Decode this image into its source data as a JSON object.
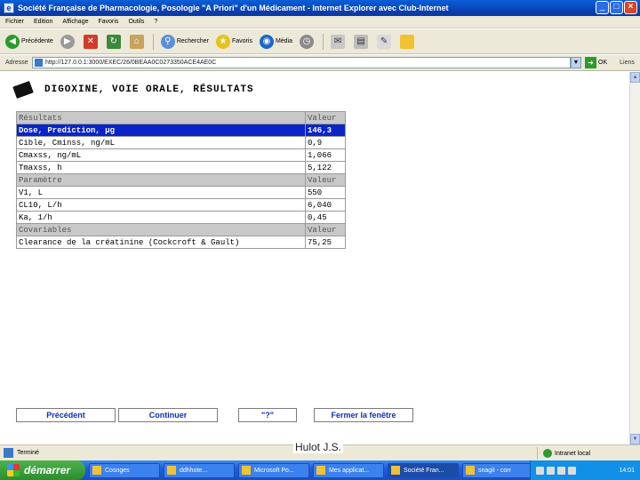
{
  "window": {
    "title": "Société Française de Pharmacologie, Posologie \"A Priori\" d'un Médicament - Internet Explorer avec Club-Internet",
    "min": "_",
    "max": "□",
    "close": "×"
  },
  "menu": [
    "Fichier",
    "Edition",
    "Affichage",
    "Favoris",
    "Outils",
    "?"
  ],
  "toolbar": {
    "back": "Précédente",
    "search": "Rechercher",
    "favorites": "Favoris",
    "media": "Média"
  },
  "address": {
    "label": "Adresse",
    "url": "http://127.0.0.1:3000/EXEC/26/0BEAA0C0273350ACE4AE0C",
    "go": "OK",
    "links": "Liens"
  },
  "page": {
    "title": "DIGOXINE, VOIE ORALE, RÉSULTATS",
    "rows": [
      {
        "kind": "section",
        "label": "Résultats",
        "value": "Valeur"
      },
      {
        "kind": "selected",
        "label": "Dose, Prediction, µg",
        "value": "146,3"
      },
      {
        "kind": "data",
        "label": "Cible, Cminss, ng/mL",
        "value": "0,9"
      },
      {
        "kind": "data",
        "label": "Cmaxss, ng/mL",
        "value": "1,066"
      },
      {
        "kind": "data",
        "label": "Tmaxss, h",
        "value": "5,122"
      },
      {
        "kind": "section",
        "label": "Paramètre",
        "value": "Valeur"
      },
      {
        "kind": "data",
        "label": "V1, L",
        "value": "550"
      },
      {
        "kind": "data",
        "label": "CL10, L/h",
        "value": "6,040"
      },
      {
        "kind": "data",
        "label": "Ka, 1/h",
        "value": "0,45"
      },
      {
        "kind": "section",
        "label": "Covariables",
        "value": "Valeur"
      },
      {
        "kind": "data",
        "label": "Clearance de la créatinine (Cockcroft & Gault)",
        "value": "75,25"
      }
    ],
    "buttons": {
      "previous": "Précédent",
      "continue": "Continuer",
      "help": "\"?\"",
      "close": "Fermer la fenêtre"
    }
  },
  "watermark": "Hulot J.S.",
  "status": {
    "text": "Terminé",
    "zone": "Intranet local"
  },
  "taskbar": {
    "start": "démarrer",
    "tasks": [
      "Cosnges",
      "ddhhote...",
      "Microsoft Po...",
      "Mes applicat...",
      "Société Fran...",
      "snagit - corr"
    ],
    "clock": "14:01"
  }
}
